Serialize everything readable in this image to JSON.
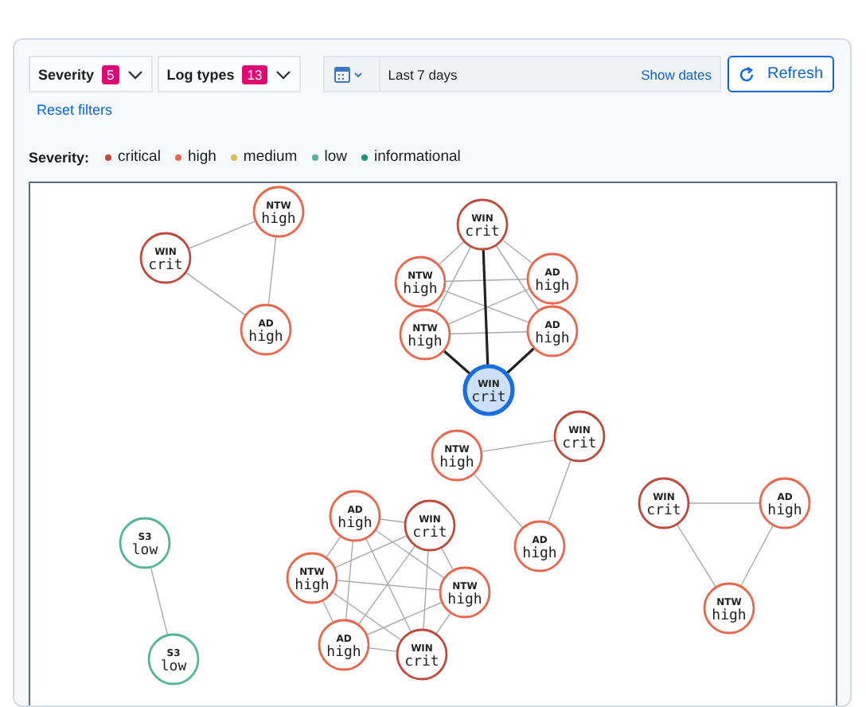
{
  "filters": [
    {
      "label": "Severity",
      "count": "5"
    },
    {
      "label": "Log types",
      "count": "13"
    }
  ],
  "date_picker": {
    "value": "Last 7 days",
    "link": "Show dates"
  },
  "refresh_button": {
    "label": "Refresh"
  },
  "reset_link": "Reset filters",
  "legend": {
    "title": "Severity:",
    "items": [
      {
        "label": "critical",
        "color": "#bd4a3c"
      },
      {
        "label": "high",
        "color": "#e7664c"
      },
      {
        "label": "medium",
        "color": "#d6bf57"
      },
      {
        "label": "low",
        "color": "#54b399"
      },
      {
        "label": "informational",
        "color": "#209280"
      }
    ]
  },
  "graph": {
    "nodes": [
      {
        "source": "NTW",
        "label": "high",
        "color": "#e7664c",
        "selected": false
      },
      {
        "source": "WIN",
        "label": "crit",
        "color": "#bd4a3c",
        "selected": false
      },
      {
        "source": "WIN",
        "label": "crit",
        "color": "#bd4a3c",
        "selected": false
      },
      {
        "source": "NTW",
        "label": "high",
        "color": "#e7664c",
        "selected": false
      },
      {
        "source": "AD",
        "label": "high",
        "color": "#e7664c",
        "selected": false
      },
      {
        "source": "AD",
        "label": "high",
        "color": "#e7664c",
        "selected": false
      },
      {
        "source": "NTW",
        "label": "high",
        "color": "#e7664c",
        "selected": false
      },
      {
        "source": "AD",
        "label": "high",
        "color": "#e7664c",
        "selected": false
      },
      {
        "source": "WIN",
        "label": "crit",
        "selected": true
      },
      {
        "source": "WIN",
        "label": "crit",
        "color": "#bd4a3c",
        "selected": false
      },
      {
        "source": "NTW",
        "label": "high",
        "color": "#e7664c",
        "selected": false
      },
      {
        "source": "WIN",
        "label": "crit",
        "color": "#bd4a3c",
        "selected": false
      },
      {
        "source": "AD",
        "label": "high",
        "color": "#e7664c",
        "selected": false
      },
      {
        "source": "S3",
        "label": "low",
        "color": "#54b399",
        "selected": false
      },
      {
        "source": "AD",
        "label": "high",
        "color": "#e7664c",
        "selected": false
      },
      {
        "source": "WIN",
        "label": "crit",
        "color": "#bd4a3c",
        "selected": false
      },
      {
        "source": "AD",
        "label": "high",
        "color": "#e7664c",
        "selected": false
      },
      {
        "source": "NTW",
        "label": "high",
        "color": "#e7664c",
        "selected": false
      },
      {
        "source": "NTW",
        "label": "high",
        "color": "#e7664c",
        "selected": false
      },
      {
        "source": "NTW",
        "label": "high",
        "color": "#e7664c",
        "selected": false
      },
      {
        "source": "S3",
        "label": "low",
        "color": "#54b399",
        "selected": false
      },
      {
        "source": "AD",
        "label": "high",
        "color": "#e7664c",
        "selected": false
      },
      {
        "source": "WIN",
        "label": "crit",
        "color": "#bd4a3c",
        "selected": false
      }
    ]
  }
}
